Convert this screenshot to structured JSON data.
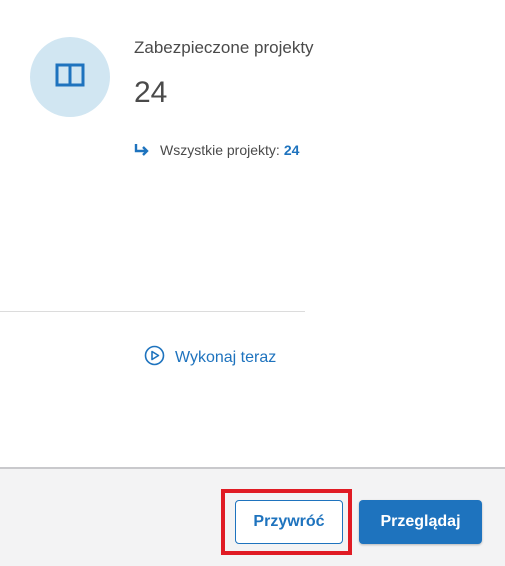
{
  "stat": {
    "title": "Zabezpieczone projekty",
    "value": "24",
    "sub_label": "Wszystkie projekty:",
    "sub_value": "24"
  },
  "actions": {
    "run_label": "Wykonaj teraz"
  },
  "footer": {
    "restore_label": "Przywróć",
    "browse_label": "Przeglądaj"
  },
  "colors": {
    "accent": "#1e73be",
    "icon_circle_bg": "#d1e6f2",
    "highlight": "#e01b24",
    "footer_bg": "#f3f3f4"
  },
  "icons": {
    "stat_icon": "book-icon",
    "sub_arrow": "return-arrow-icon",
    "run_icon": "play-circle-icon"
  }
}
